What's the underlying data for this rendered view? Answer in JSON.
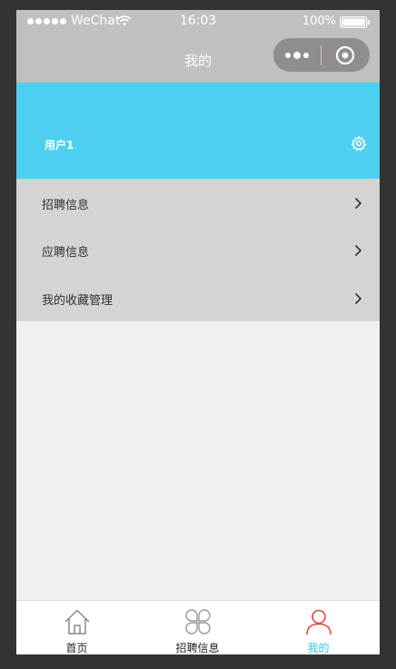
{
  "status_bar": {
    "carrier": "WeChat",
    "time": "16:03",
    "battery": "100%"
  },
  "nav": {
    "title": "我的"
  },
  "user": {
    "name": "用户1"
  },
  "menu": {
    "items": [
      {
        "label": "招聘信息"
      },
      {
        "label": "应聘信息"
      },
      {
        "label": "我的收藏管理"
      }
    ]
  },
  "tabbar": {
    "tabs": [
      {
        "label": "首页",
        "icon": "home-icon"
      },
      {
        "label": "招聘信息",
        "icon": "clover-icon"
      },
      {
        "label": "我的",
        "icon": "person-icon",
        "active": true
      }
    ]
  },
  "colors": {
    "header_bg": "#c3bfbd",
    "banner_bg": "#4dd0f0",
    "menu_bg": "#d6d3d1",
    "accent": "#2fc8ee",
    "active_icon": "#e2483b"
  }
}
